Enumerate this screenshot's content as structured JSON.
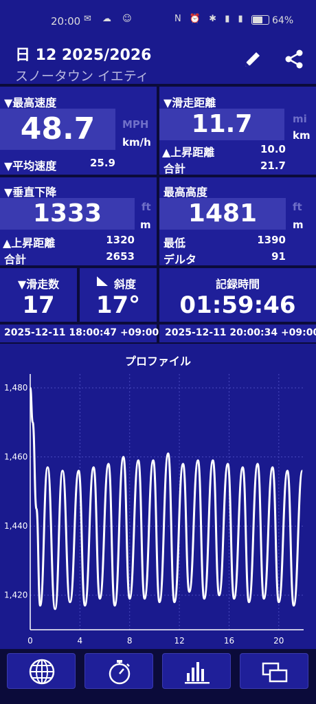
{
  "status_bar": {
    "time": "20:00",
    "left_icons": "✉ ☁ ☺",
    "right_icons": "N ⏰ ✱ ▮ ▮",
    "battery": "64%"
  },
  "header": {
    "title": "日 12 2025/2026",
    "subtitle": "スノータウン イエティ",
    "edit_icon": "pencil-icon",
    "share_icon": "share-icon"
  },
  "max_speed": {
    "label": "▼最高速度",
    "value": "48.7",
    "unit_alt": "MPH",
    "unit": "km/h",
    "avg_label": "▼平均速度",
    "avg_value": "25.9"
  },
  "ski_distance": {
    "label": "▼滑走距離",
    "value": "11.7",
    "unit_alt": "mi",
    "unit": "km",
    "ascent_label": "▲上昇距離",
    "ascent_value": "10.0",
    "total_label": "合計",
    "total_value": "21.7"
  },
  "vertical_descent": {
    "label": "▼垂直下降",
    "value": "1333",
    "unit_alt": "ft",
    "unit": "m",
    "ascent_label": "▲上昇距離",
    "ascent_value": "1320",
    "total_label": "合計",
    "total_value": "2653"
  },
  "max_altitude": {
    "label": "最高高度",
    "value": "1481",
    "unit_alt": "ft",
    "unit": "m",
    "min_label": "最低",
    "min_value": "1390",
    "delta_label": "デルタ",
    "delta_value": "91"
  },
  "runs": {
    "label": "▼滑走数",
    "value": "17"
  },
  "slope": {
    "label": "斜度",
    "value": "17°"
  },
  "record_time": {
    "label": "記録時間",
    "value": "01:59:46"
  },
  "start_time": "2025-12-11 18:00:47 +09:00",
  "end_time": "2025-12-11 20:00:34 +09:00",
  "chart_data": {
    "type": "line",
    "title": "プロファイル",
    "xlabel": "",
    "ylabel": "",
    "xlim": [
      0,
      22
    ],
    "ylim": [
      1410,
      1484
    ],
    "x_ticks": [
      0,
      4,
      8,
      12,
      16,
      20
    ],
    "y_ticks": [
      1420,
      1440,
      1460,
      1480
    ],
    "y_tick_labels": [
      "1,420",
      "1,440",
      "1,460",
      "1,480"
    ],
    "grid": true,
    "series": [
      {
        "x": [
          0,
          0.2,
          0.5,
          0.8,
          1.4,
          2.0,
          2.6,
          3.2,
          3.9,
          4.4,
          5.1,
          5.6,
          6.3,
          6.8,
          7.5,
          8.0,
          8.7,
          9.2,
          9.9,
          10.4,
          11.1,
          11.6,
          12.3,
          12.8,
          13.5,
          14.0,
          14.7,
          15.2,
          15.9,
          16.4,
          17.1,
          17.6,
          18.3,
          18.8,
          19.5,
          20.0,
          20.7,
          21.2,
          21.9
        ],
        "y": [
          1480,
          1470,
          1445,
          1417,
          1457,
          1416,
          1456,
          1418,
          1456,
          1417,
          1457,
          1419,
          1458,
          1417,
          1460,
          1419,
          1459,
          1419,
          1459,
          1418,
          1461,
          1418,
          1458,
          1421,
          1459,
          1419,
          1459,
          1420,
          1458,
          1419,
          1457,
          1418,
          1458,
          1419,
          1457,
          1418,
          1456,
          1417,
          1456
        ]
      }
    ]
  },
  "nav": {
    "globe": "globe-icon",
    "timer": "stopwatch-icon",
    "stats": "bar-chart-icon",
    "pages": "windows-icon"
  },
  "colors": {
    "background": "#1a1a8e",
    "panel": "#1f1f99",
    "highlight": "#3a3ab0",
    "divider": "#0b0b3a",
    "line": "#ffffff"
  }
}
